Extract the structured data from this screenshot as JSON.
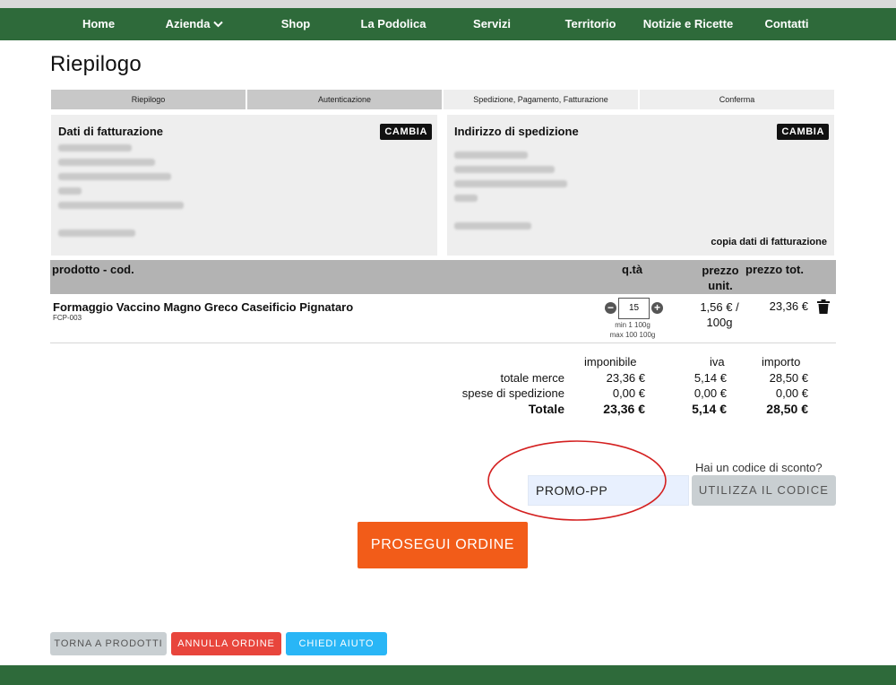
{
  "nav": {
    "items": [
      {
        "label": "Home"
      },
      {
        "label": "Azienda"
      },
      {
        "label": "Shop"
      },
      {
        "label": "La Podolica"
      },
      {
        "label": "Servizi"
      },
      {
        "label": "Territorio"
      },
      {
        "label": "Notizie e Ricette"
      },
      {
        "label": "Contatti"
      }
    ]
  },
  "page": {
    "title": "Riepilogo"
  },
  "steps": [
    {
      "label": "Riepilogo"
    },
    {
      "label": "Autenticazione"
    },
    {
      "label": "Spedizione, Pagamento, Fatturazione"
    },
    {
      "label": "Conferma"
    }
  ],
  "billing": {
    "title": "Dati di fatturazione",
    "change_label": "CAMBIA"
  },
  "shipping": {
    "title": "Indirizzo di spedizione",
    "change_label": "CAMBIA",
    "copy_label": "copia dati di fatturazione"
  },
  "table": {
    "headers": {
      "product": "prodotto - cod.",
      "qty": "q.tà",
      "unit_price": "prezzo unit.",
      "total_price": "prezzo tot."
    }
  },
  "product": {
    "name": "Formaggio Vaccino Magno Greco Caseificio Pignataro",
    "code": "FCP-003",
    "qty": "15",
    "qty_min": "min 1 100g",
    "qty_max": "max 100 100g",
    "unit_price": "1,56 € / 100g",
    "total_price": "23,36 €"
  },
  "summary": {
    "headers": {
      "imponibile": "imponibile",
      "iva": "iva",
      "importo": "importo"
    },
    "rows": [
      {
        "label": "totale merce",
        "imponibile": "23,36 €",
        "iva": "5,14 €",
        "importo": "28,50 €"
      },
      {
        "label": "spese di spedizione",
        "imponibile": "0,00 €",
        "iva": "0,00 €",
        "importo": "0,00 €"
      },
      {
        "label": "Totale",
        "imponibile": "23,36 €",
        "iva": "5,14 €",
        "importo": "28,50 €"
      }
    ]
  },
  "discount": {
    "question": "Hai un codice di sconto?",
    "code_value": "PROMO-PP",
    "apply_label": "UTILIZZA IL CODICE"
  },
  "actions": {
    "continue_label": "PROSEGUI ORDINE",
    "back_label": "TORNA A PRODOTTI",
    "cancel_label": "ANNULLA ORDINE",
    "help_label": "CHIEDI AIUTO"
  },
  "colors": {
    "nav_bg": "#2e6a3a",
    "continue_bg": "#f25c19",
    "cancel_bg": "#e8453c",
    "help_bg": "#29b6f6",
    "back_bg": "#c9cfd2",
    "highlight": "#d42020"
  }
}
